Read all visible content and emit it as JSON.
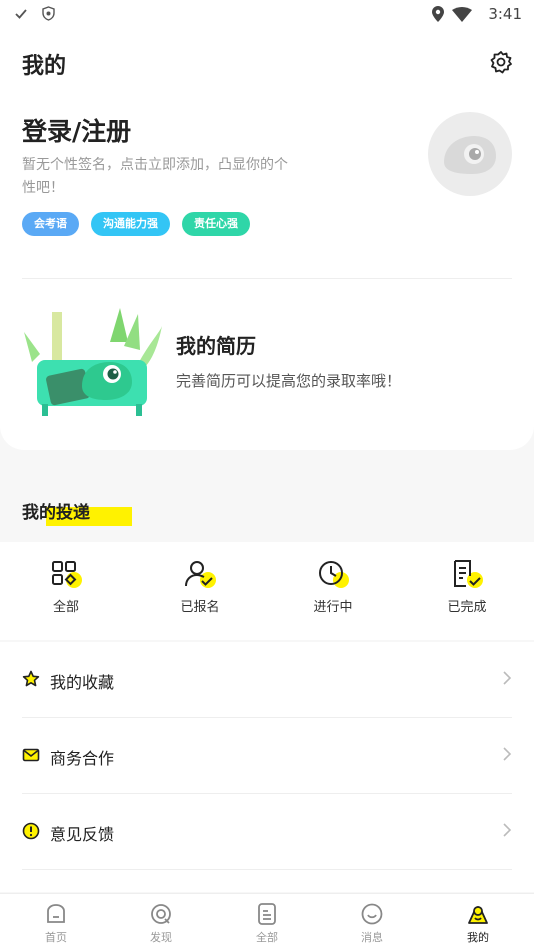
{
  "status_bar": {
    "time": "3:41"
  },
  "header": {
    "title": "我的"
  },
  "profile": {
    "login_text": "登录/注册",
    "signature": "暂无个性签名，点击立即添加，凸显你的个性吧！",
    "tags": [
      {
        "label": "会考语",
        "color": "#5aa9f5"
      },
      {
        "label": "沟通能力强",
        "color": "#33c5f5"
      },
      {
        "label": "责任心强",
        "color": "#2fd6a8"
      }
    ]
  },
  "resume": {
    "title": "我的简历",
    "description": "完善简历可以提高您的录取率哦！"
  },
  "deliveries": {
    "title": "我的投递",
    "items": [
      {
        "label": "全部",
        "icon": "grid-icon"
      },
      {
        "label": "已报名",
        "icon": "user-check-icon"
      },
      {
        "label": "进行中",
        "icon": "clock-icon"
      },
      {
        "label": "已完成",
        "icon": "document-check-icon"
      }
    ]
  },
  "menu": [
    {
      "label": "我的收藏",
      "icon": "star-icon"
    },
    {
      "label": "商务合作",
      "icon": "mail-icon"
    },
    {
      "label": "意见反馈",
      "icon": "feedback-icon"
    }
  ],
  "tabbar": [
    {
      "label": "首页",
      "icon": "home-icon"
    },
    {
      "label": "发现",
      "icon": "discover-icon"
    },
    {
      "label": "全部",
      "icon": "all-icon"
    },
    {
      "label": "消息",
      "icon": "message-icon"
    },
    {
      "label": "我的",
      "icon": "profile-icon",
      "active": true
    }
  ],
  "colors": {
    "accent_yellow": "#fff200",
    "brand_green": "#35d49e"
  }
}
